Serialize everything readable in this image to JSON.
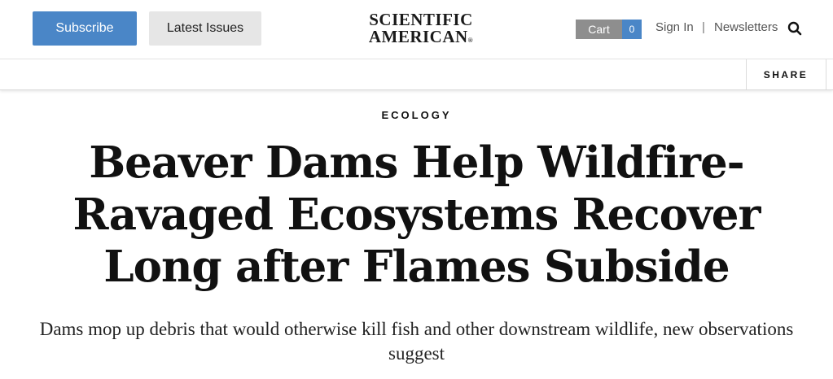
{
  "header": {
    "subscribe_label": "Subscribe",
    "latest_issues_label": "Latest Issues",
    "logo_line1": "SCIENTIFIC",
    "logo_line2": "AMERICAN",
    "logo_mark": "®",
    "cart_label": "Cart",
    "cart_count": "0",
    "sign_in_label": "Sign In",
    "separator": "|",
    "newsletters_label": "Newsletters",
    "search_icon": "search-icon"
  },
  "sharebar": {
    "share_label": "SHARE"
  },
  "article": {
    "category": "ECOLOGY",
    "headline": "Beaver Dams Help Wildfire-Ravaged Ecosystems Recover Long after Flames Subside",
    "dek": "Dams mop up debris that would otherwise kill fish and other downstream wildlife, new observations suggest"
  },
  "colors": {
    "subscribe_bg": "#4a86c7",
    "latest_bg": "#e6e6e6",
    "cart_bg": "#8e8e8e",
    "cart_count_bg": "#4a86c7"
  }
}
